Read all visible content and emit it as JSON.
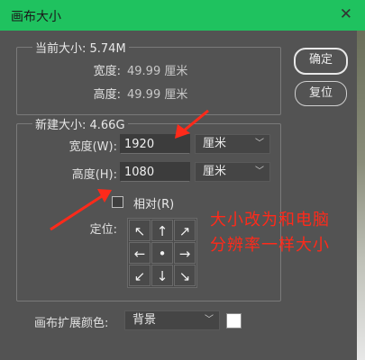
{
  "window": {
    "title": "画布大小",
    "close_icon": "close-icon"
  },
  "current_size": {
    "legend": "当前大小: 5.74M",
    "width_label": "宽度:",
    "width_value": "49.99 厘米",
    "height_label": "高度:",
    "height_value": "49.99 厘米"
  },
  "new_size": {
    "legend": "新建大小: 4.66G",
    "width_label": "宽度(W):",
    "width_value": "1920",
    "width_unit": "厘米",
    "height_label": "高度(H):",
    "height_value": "1080",
    "height_unit": "厘米",
    "relative_label": "相对(R)",
    "relative_checked": false,
    "anchor_label": "定位:",
    "anchor_arrows": [
      "↖",
      "↑",
      "↗",
      "←",
      "•",
      "→",
      "↙",
      "↓",
      "↘"
    ]
  },
  "buttons": {
    "ok": "确定",
    "reset": "复位"
  },
  "extension": {
    "label": "画布扩展颜色:",
    "value": "背景",
    "swatch_color": "#ffffff"
  },
  "annotation": {
    "line1": "大小改为和电脑",
    "line2": "分辨率一样大小",
    "color": "#ff2a1a"
  }
}
